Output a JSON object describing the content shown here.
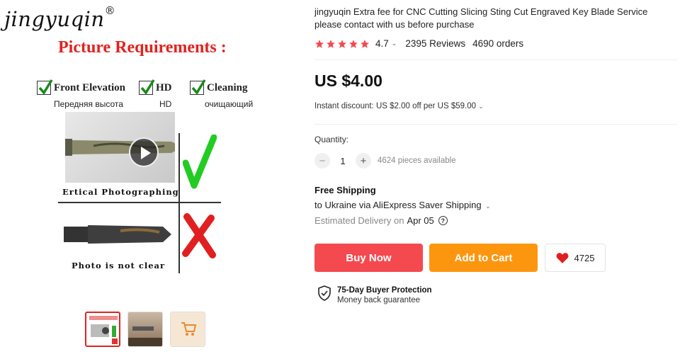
{
  "gallery": {
    "brand": "jingyuqin",
    "brand_mark": "®",
    "heading": "Picture Requirements :",
    "requirements": [
      {
        "label": "Front Elevation",
        "sub": "Передняя высота"
      },
      {
        "label": "HD",
        "sub": "HD"
      },
      {
        "label": "Cleaning",
        "sub": "очищающий"
      }
    ],
    "caption_good": "Ertical Photographing",
    "caption_bad": "Photo is not clear",
    "thumbnails_count": 3,
    "selected_thumbnail": 1
  },
  "product": {
    "title": "jingyuqin Extra fee for CNC Cutting Slicing Sting Cut Engraved Key Blade Service please contact with us before purchase",
    "rating": "4.7",
    "rating_stars": 5,
    "reviews": "2395 Reviews",
    "orders": "4690 orders",
    "price": "US $4.00",
    "discount": "Instant discount: US $2.00 off per US $59.00"
  },
  "quantity": {
    "label": "Quantity:",
    "minus": "−",
    "value": "1",
    "plus": "+",
    "available": "4624 pieces available"
  },
  "shipping": {
    "title": "Free Shipping",
    "destination": "to Ukraine via AliExpress Saver Shipping",
    "delivery_prefix": "Estimated Delivery on",
    "delivery_date": "Apr 05",
    "help": "?"
  },
  "actions": {
    "buy_now": "Buy Now",
    "add_to_cart": "Add to Cart",
    "wishlist_count": "4725"
  },
  "protection": {
    "title": "75-Day Buyer Protection",
    "subtitle": "Money back guarantee"
  },
  "colors": {
    "star": "#f4494e",
    "buy_now": "#f4494e",
    "add_to_cart": "#fd960f",
    "heart": "#e02020",
    "heading_red": "#e0231f"
  }
}
